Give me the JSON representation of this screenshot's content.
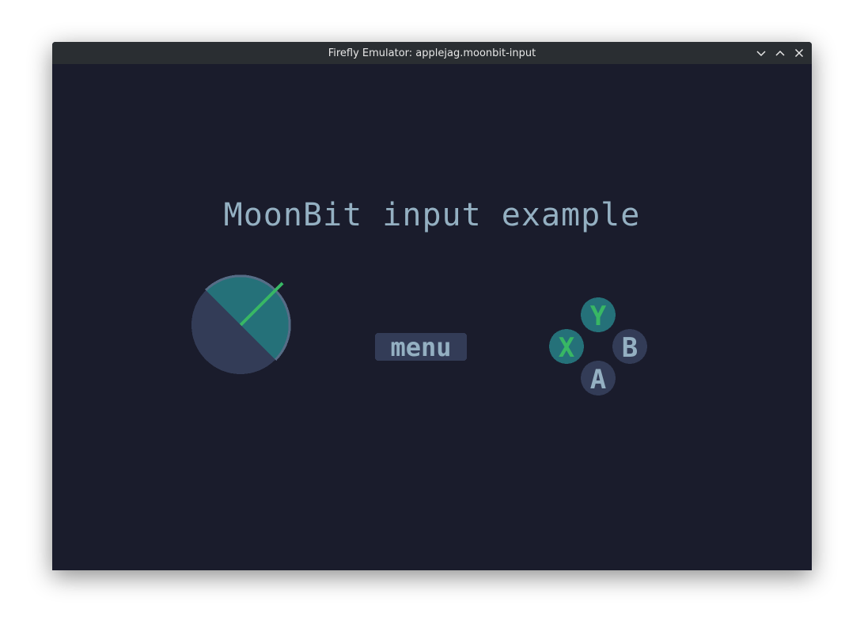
{
  "window": {
    "title": "Firefly Emulator: applejag.moonbit-input",
    "controls": [
      "minimize-icon",
      "maximize-icon",
      "close-icon"
    ]
  },
  "app": {
    "heading": "MoonBit input example",
    "menu_label": "menu",
    "buttons": {
      "y": "Y",
      "x": "X",
      "b": "B",
      "a": "A"
    },
    "pressed": {
      "y": true,
      "x": true,
      "b": false,
      "a": false
    },
    "colors": {
      "background": "#1a1c2c",
      "text": "#94b0c2",
      "pressed": "#257179",
      "idle": "#333c57",
      "indicator": "#38b764",
      "rim": "#566c86"
    }
  }
}
